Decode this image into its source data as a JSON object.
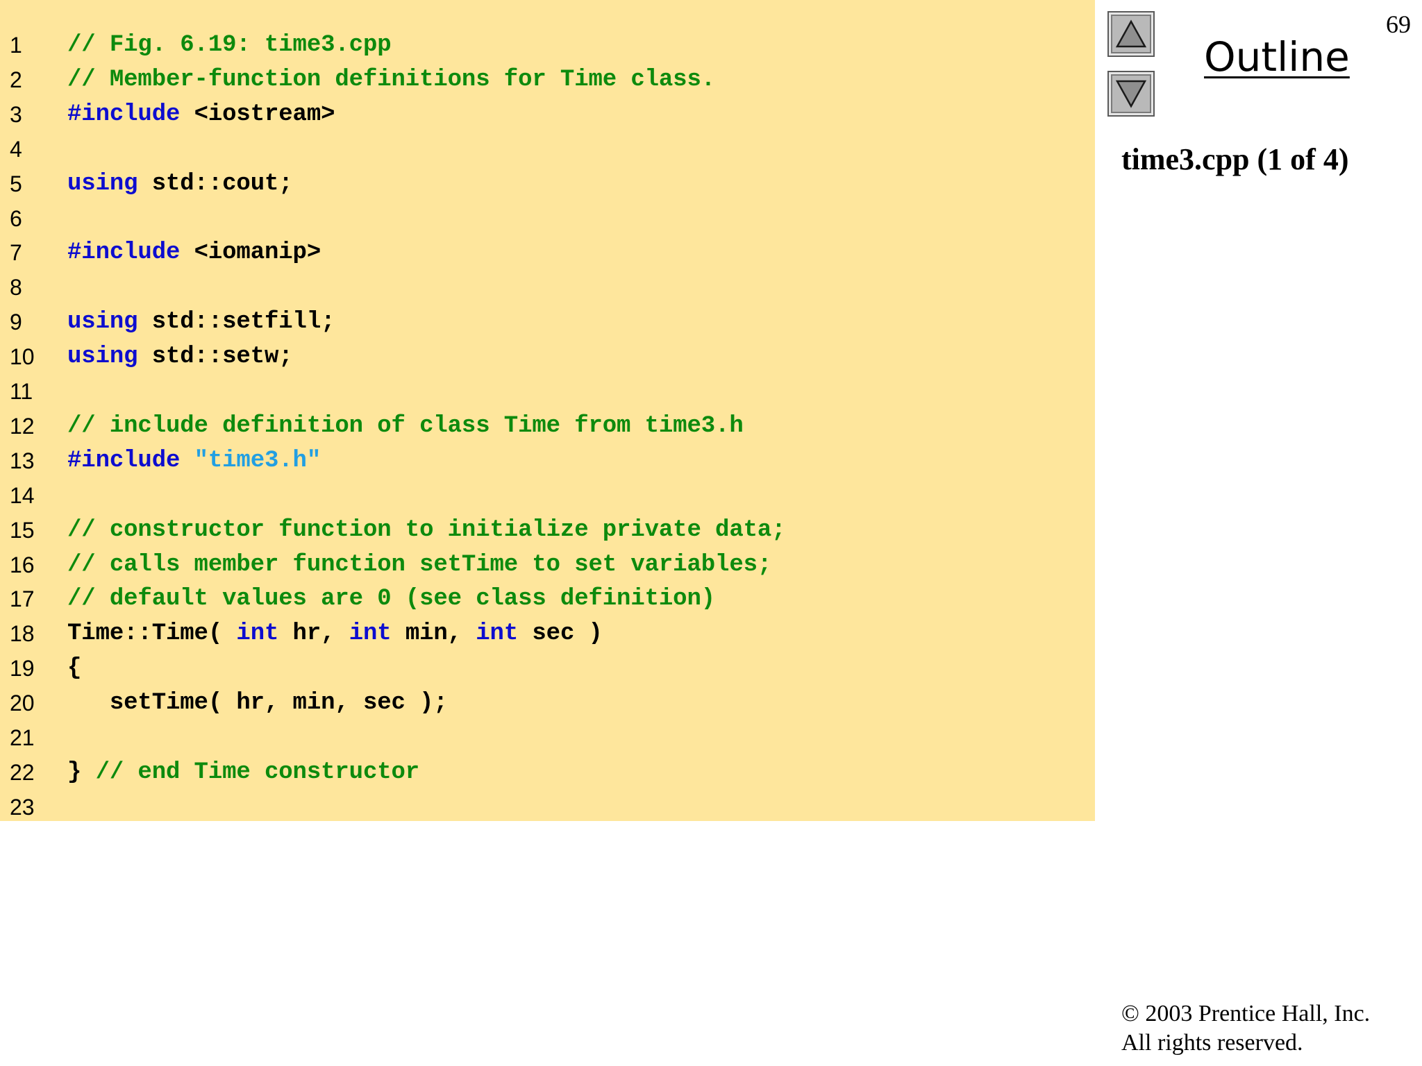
{
  "page_number": "69",
  "outline": {
    "label": "Outline",
    "up_icon": "up-triangle-icon",
    "down_icon": "down-triangle-icon"
  },
  "file_label": "time3.cpp (1 of 4)",
  "copyright": {
    "line1": "© 2003 Prentice Hall, Inc.",
    "line2": "All rights reserved."
  },
  "colors": {
    "panel_bg": "#fee69c",
    "comment": "#0d8a0d",
    "keyword": "#0d0dcf",
    "string": "#229fe2",
    "plain": "#000000"
  },
  "code_lines": [
    {
      "n": "1",
      "tokens": [
        {
          "t": "comment",
          "v": "// Fig. 6.19: time3.cpp"
        }
      ]
    },
    {
      "n": "2",
      "tokens": [
        {
          "t": "comment",
          "v": "// Member-function definitions for Time class."
        }
      ]
    },
    {
      "n": "3",
      "tokens": [
        {
          "t": "keyword",
          "v": "#include"
        },
        {
          "t": "plain",
          "v": " <iostream>"
        }
      ]
    },
    {
      "n": "4",
      "tokens": []
    },
    {
      "n": "5",
      "tokens": [
        {
          "t": "keyword",
          "v": "using"
        },
        {
          "t": "plain",
          "v": " std::cout;"
        }
      ]
    },
    {
      "n": "6",
      "tokens": []
    },
    {
      "n": "7",
      "tokens": [
        {
          "t": "keyword",
          "v": "#include"
        },
        {
          "t": "plain",
          "v": " <iomanip>"
        }
      ]
    },
    {
      "n": "8",
      "tokens": []
    },
    {
      "n": "9",
      "tokens": [
        {
          "t": "keyword",
          "v": "using"
        },
        {
          "t": "plain",
          "v": " std::setfill;"
        }
      ]
    },
    {
      "n": "10",
      "tokens": [
        {
          "t": "keyword",
          "v": "using"
        },
        {
          "t": "plain",
          "v": " std::setw;"
        }
      ]
    },
    {
      "n": "11",
      "tokens": []
    },
    {
      "n": "12",
      "tokens": [
        {
          "t": "comment",
          "v": "// include definition of class Time from time3.h"
        }
      ]
    },
    {
      "n": "13",
      "tokens": [
        {
          "t": "keyword",
          "v": "#include"
        },
        {
          "t": "plain",
          "v": " "
        },
        {
          "t": "string",
          "v": "\"time3.h\""
        }
      ]
    },
    {
      "n": "14",
      "tokens": []
    },
    {
      "n": "15",
      "tokens": [
        {
          "t": "comment",
          "v": "// constructor function to initialize private data;"
        }
      ]
    },
    {
      "n": "16",
      "tokens": [
        {
          "t": "comment",
          "v": "// calls member function setTime to set variables;"
        }
      ]
    },
    {
      "n": "17",
      "tokens": [
        {
          "t": "comment",
          "v": "// default values are 0 (see class definition)"
        }
      ]
    },
    {
      "n": "18",
      "tokens": [
        {
          "t": "plain",
          "v": "Time::Time( "
        },
        {
          "t": "keyword",
          "v": "int"
        },
        {
          "t": "plain",
          "v": " hr, "
        },
        {
          "t": "keyword",
          "v": "int"
        },
        {
          "t": "plain",
          "v": " min, "
        },
        {
          "t": "keyword",
          "v": "int"
        },
        {
          "t": "plain",
          "v": " sec )"
        }
      ]
    },
    {
      "n": "19",
      "tokens": [
        {
          "t": "plain",
          "v": "{"
        }
      ]
    },
    {
      "n": "20",
      "tokens": [
        {
          "t": "plain",
          "v": "   setTime( hr, min, sec );"
        }
      ]
    },
    {
      "n": "21",
      "tokens": []
    },
    {
      "n": "22",
      "tokens": [
        {
          "t": "plain",
          "v": "} "
        },
        {
          "t": "comment",
          "v": "// end Time constructor"
        }
      ]
    },
    {
      "n": "23",
      "tokens": []
    }
  ]
}
